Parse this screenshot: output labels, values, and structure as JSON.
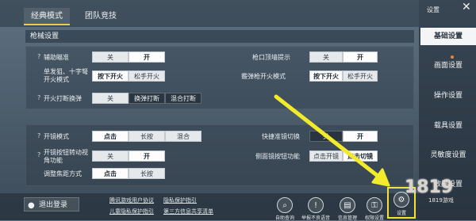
{
  "tabs": {
    "classic": "经典模式",
    "team": "团队竞技"
  },
  "sections": {
    "weapon": "枪械设置"
  },
  "settings": {
    "assist_aim": {
      "label": "辅助瞄准",
      "off": "关",
      "on": "开"
    },
    "single_fire": {
      "label": "单发狙、十字弩开火模式",
      "press": "按下开火",
      "release": "松手开火"
    },
    "fire_swap": {
      "label": "开火打断换弹",
      "off": "关",
      "swap": "换弹打断",
      "mixed": "混合打断"
    },
    "top_hint": {
      "label": "枪口顶墙提示",
      "off": "关",
      "on": "开"
    },
    "shotgun_fire": {
      "label": "霰弹枪开火模式",
      "press": "按下开火",
      "release": "松手开火"
    },
    "scope_mode": {
      "label": "开镜模式",
      "tap": "点击",
      "hold": "长按",
      "mixed": "混合"
    },
    "scope_btn_view": {
      "label": "开镜按钮转动视角功能",
      "off": "关",
      "on": "开"
    },
    "zoom_mode": {
      "label": "调整焦距方式",
      "tap": "点击",
      "hold": "长按"
    },
    "quick_scope": {
      "label": "快捷准镜切换",
      "off": "关",
      "on": "开"
    },
    "side_scope": {
      "label": "侧面镜按钮功能",
      "tap": "点击开镜",
      "switch": "点击切镜"
    }
  },
  "sidebar": {
    "title": "设置",
    "close": "✕",
    "items": [
      "基础设置",
      "画面设置",
      "操作设置",
      "载具设置",
      "灵敏度设置",
      "效果设置"
    ]
  },
  "bottom": {
    "logout": "退出登录",
    "links": [
      "腾讯游戏用户协议",
      "隐私保护指引",
      "儿童隐私保护指引",
      "第三方信息共享清单"
    ],
    "icons": [
      "自助查询",
      "举报不良语音",
      "信息管理",
      "权限设置",
      "设置"
    ]
  },
  "watermark": "1819游戏"
}
